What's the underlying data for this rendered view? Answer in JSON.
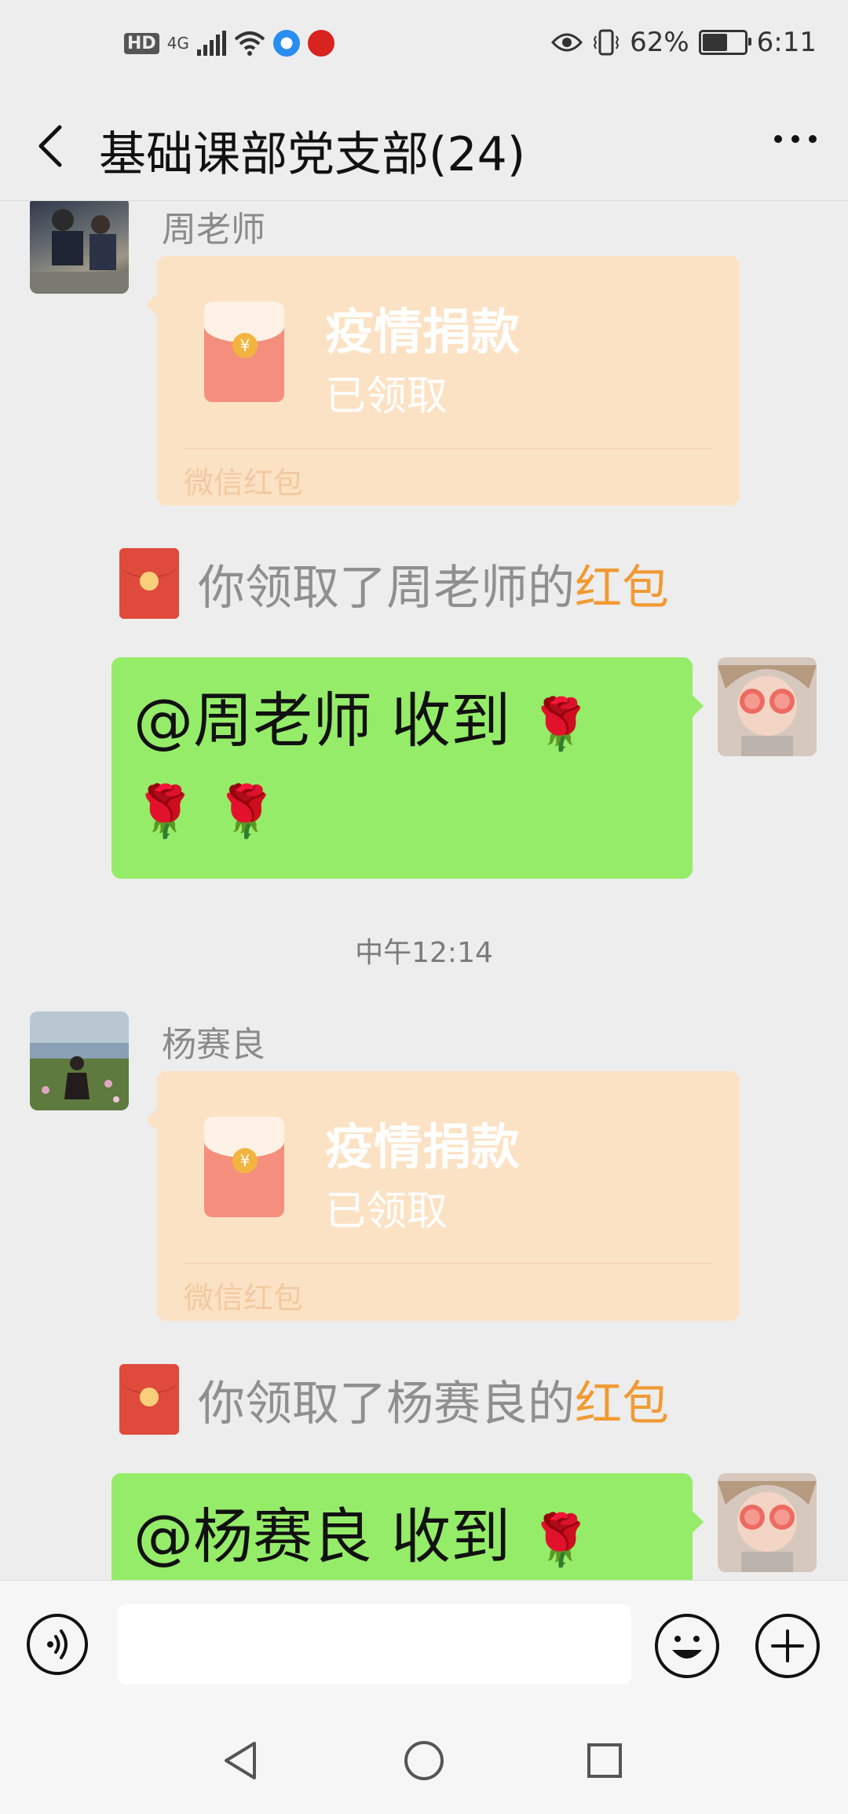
{
  "status_bar": {
    "hd": "HD",
    "network": "4G",
    "eye_icon": "eye-icon",
    "vibrate_icon": "vibrate-icon",
    "battery_percent": "62%",
    "battery_level": 0.62,
    "time": "6:11"
  },
  "header": {
    "title": "基础课部党支部(24)",
    "back_icon": "chevron-left-icon",
    "more_icon": "more-dots-icon"
  },
  "messages": {
    "m1": {
      "sender": "周老师",
      "redpacket_title": "疫情捐款",
      "redpacket_status": "已领取",
      "redpacket_footer": "微信红包"
    },
    "n1": {
      "prefix": "你领取了周老师的",
      "highlight": "红包"
    },
    "r1": {
      "text": "@周老师  收到",
      "roses": [
        "🌹",
        "🌹",
        "🌹"
      ]
    },
    "timestamp": "中午12:14",
    "m2": {
      "sender": "杨赛良",
      "redpacket_title": "疫情捐款",
      "redpacket_status": "已领取",
      "redpacket_footer": "微信红包"
    },
    "n2": {
      "prefix": "你领取了杨赛良的",
      "highlight": "红包"
    },
    "r2": {
      "text": "@杨赛良  收到",
      "roses": [
        "🌹"
      ]
    }
  },
  "input_bar": {
    "placeholder": "",
    "voice_icon": "voice-icon",
    "emoji_icon": "emoji-icon",
    "plus_icon": "plus-icon"
  },
  "nav_bar": {
    "back_icon": "nav-back-icon",
    "home_icon": "nav-home-icon",
    "recents_icon": "nav-recents-icon"
  },
  "colors": {
    "background": "#ededed",
    "my_bubble": "#95ec69",
    "redpacket": "#fce2c4",
    "highlight": "#f19a33"
  }
}
